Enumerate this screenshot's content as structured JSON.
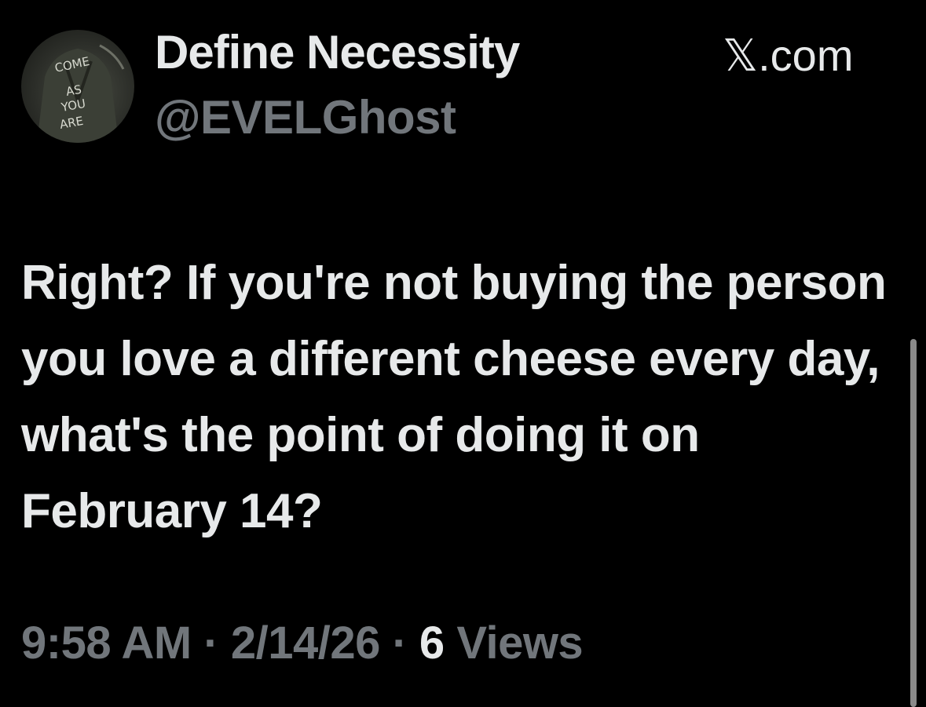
{
  "header": {
    "display_name": "Define Necessity",
    "handle": "@EVELGhost",
    "site": "𝕏.com",
    "avatar": {
      "icon": "avatar-photo-jacket",
      "text_lines": [
        "COME",
        "AS",
        "YOU",
        "ARE"
      ]
    }
  },
  "tweet": {
    "text": "Right? If you're not buying the person you love a different cheese every day, what's the point of doing it on February 14?"
  },
  "meta": {
    "time": "9:58 AM",
    "separator": "·",
    "date": "2/14/26",
    "views_count": "6",
    "views_label": "Views"
  },
  "colors": {
    "background": "#000000",
    "primary_text": "#e7e9ea",
    "secondary_text": "#71767b"
  }
}
